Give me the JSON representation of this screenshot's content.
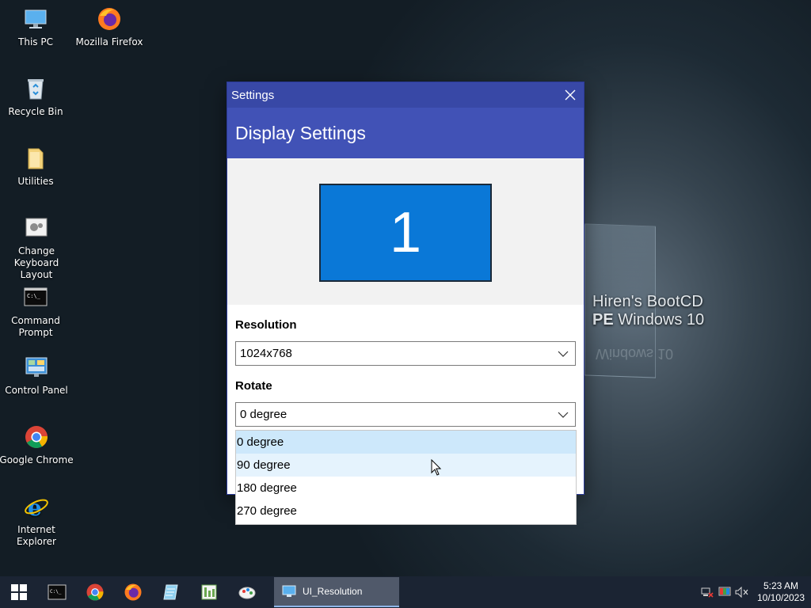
{
  "desktop": {
    "icons": [
      {
        "label": "This PC",
        "icon": "this-pc-icon"
      },
      {
        "label": "Mozilla Firefox",
        "icon": "firefox-icon"
      },
      {
        "label": "Recycle Bin",
        "icon": "recycle-bin-icon"
      },
      {
        "label": "Utilities",
        "icon": "folder-icon"
      },
      {
        "label": "Change Keyboard Layout",
        "icon": "keyboard-layout-icon"
      },
      {
        "label": "Command Prompt",
        "icon": "command-prompt-icon"
      },
      {
        "label": "Control Panel",
        "icon": "control-panel-icon"
      },
      {
        "label": "Google Chrome",
        "icon": "chrome-icon"
      },
      {
        "label": "Internet Explorer",
        "icon": "internet-explorer-icon"
      }
    ],
    "watermark": {
      "line1": "Hiren's BootCD",
      "line2_bold": "PE",
      "line2_rest": " Windows 10",
      "mirror": "Windows 10"
    }
  },
  "window": {
    "title": "Settings",
    "header": "Display Settings",
    "monitor_number": "1",
    "resolution_label": "Resolution",
    "resolution_value": "1024x768",
    "rotate_label": "Rotate",
    "rotate_value": "0 degree",
    "rotate_options": [
      "0 degree",
      "90 degree",
      "180 degree",
      "270 degree"
    ],
    "rotate_selected_index": 0,
    "rotate_hover_index": 1
  },
  "taskbar": {
    "active_app": "UI_Resolution",
    "pinned": [
      "start-icon",
      "command-prompt-icon",
      "chrome-icon",
      "firefox-icon",
      "notepad-icon",
      "spreadsheet-icon",
      "paint-icon"
    ],
    "clock_time": "5:23 AM",
    "clock_date": "10/10/2023"
  },
  "colors": {
    "title_bar": "#3848a6",
    "header": "#4152b6",
    "monitor": "#0a78d7",
    "selected_option": "#cde8fb",
    "taskbar": "#1b2433"
  }
}
